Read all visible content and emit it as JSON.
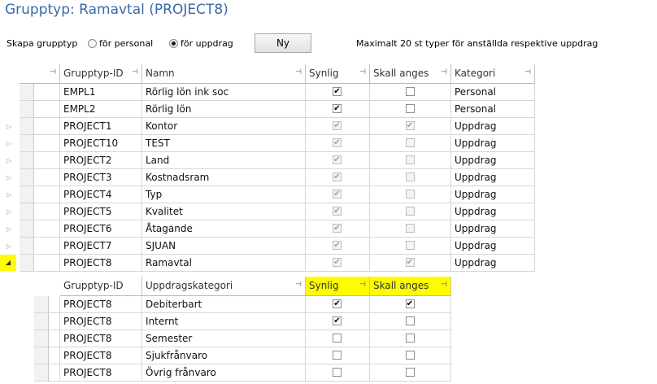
{
  "title": "Grupptyp: Ramavtal (PROJECT8)",
  "controls": {
    "label": "Skapa grupptyp",
    "radio_personal": "för personal",
    "radio_uppdrag": "för uppdrag",
    "selected": "för uppdrag",
    "new_button": "Ny",
    "note": "Maximalt 20 st typer för anställda respektive uppdrag"
  },
  "grid": {
    "columns": [
      "Grupptyp-ID",
      "Namn",
      "Synlig",
      "Skall anges",
      "Kategori"
    ],
    "rows": [
      {
        "id": "EMPL1",
        "name": "Rörlig lön ink soc",
        "synlig": true,
        "skall": false,
        "kategori": "Personal",
        "enabled": true,
        "expander": ""
      },
      {
        "id": "EMPL2",
        "name": "Rörlig lön",
        "synlig": true,
        "skall": false,
        "kategori": "Personal",
        "enabled": true,
        "expander": ""
      },
      {
        "id": "PROJECT1",
        "name": "Kontor",
        "synlig": true,
        "skall": true,
        "kategori": "Uppdrag",
        "enabled": false,
        "expander": "▷"
      },
      {
        "id": "PROJECT10",
        "name": "TEST",
        "synlig": true,
        "skall": false,
        "kategori": "Uppdrag",
        "enabled": false,
        "expander": "▷"
      },
      {
        "id": "PROJECT2",
        "name": "Land",
        "synlig": true,
        "skall": false,
        "kategori": "Uppdrag",
        "enabled": false,
        "expander": "▷"
      },
      {
        "id": "PROJECT3",
        "name": "Kostnadsram",
        "synlig": true,
        "skall": false,
        "kategori": "Uppdrag",
        "enabled": false,
        "expander": "▷"
      },
      {
        "id": "PROJECT4",
        "name": "Typ",
        "synlig": true,
        "skall": false,
        "kategori": "Uppdrag",
        "enabled": false,
        "expander": "▷"
      },
      {
        "id": "PROJECT5",
        "name": "Kvalitet",
        "synlig": true,
        "skall": false,
        "kategori": "Uppdrag",
        "enabled": false,
        "expander": "▷"
      },
      {
        "id": "PROJECT6",
        "name": "Åtagande",
        "synlig": true,
        "skall": false,
        "kategori": "Uppdrag",
        "enabled": false,
        "expander": "▷"
      },
      {
        "id": "PROJECT7",
        "name": "SJUAN",
        "synlig": true,
        "skall": false,
        "kategori": "Uppdrag",
        "enabled": false,
        "expander": "▷"
      },
      {
        "id": "PROJECT8",
        "name": "Ramavtal",
        "synlig": true,
        "skall": true,
        "kategori": "Uppdrag",
        "enabled": false,
        "expander": "◢",
        "expanded": true
      }
    ]
  },
  "subgrid": {
    "columns": [
      "Grupptyp-ID",
      "Uppdragskategori",
      "Synlig",
      "Skall anges"
    ],
    "rows": [
      {
        "id": "PROJECT8",
        "kategori": "Debiterbart",
        "synlig": true,
        "skall": true
      },
      {
        "id": "PROJECT8",
        "kategori": "Internt",
        "synlig": true,
        "skall": false
      },
      {
        "id": "PROJECT8",
        "kategori": "Semester",
        "synlig": false,
        "skall": false
      },
      {
        "id": "PROJECT8",
        "kategori": "Sjukfrånvaro",
        "synlig": false,
        "skall": false
      },
      {
        "id": "PROJECT8",
        "kategori": "Övrig frånvaro",
        "synlig": false,
        "skall": false
      }
    ]
  },
  "colors": {
    "title": "#3a6aa8",
    "highlight": "#fffb00",
    "pin": "#2a63b0"
  },
  "icons": {
    "pin": "pin-icon",
    "expand": "expand-arrow-icon",
    "expanded": "expanded-arrow-icon"
  }
}
